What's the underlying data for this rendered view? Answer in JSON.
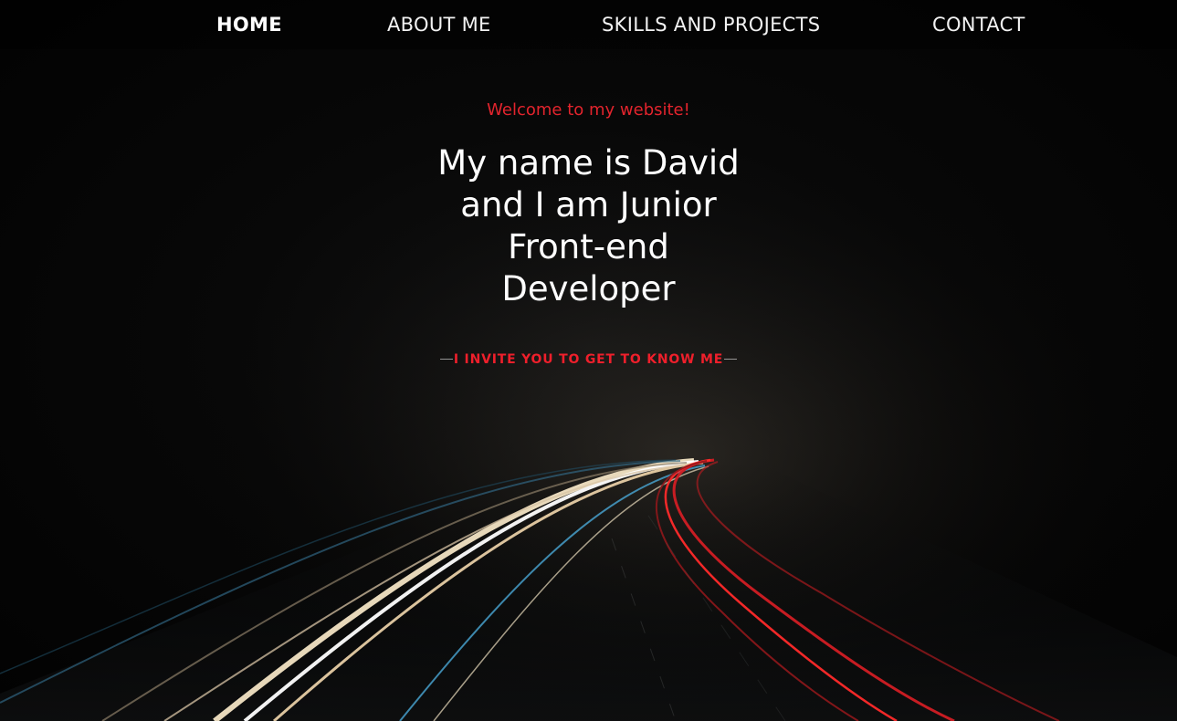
{
  "nav": {
    "home_label": "HOME",
    "about_label": "ABOUT ME",
    "skills_label": "SKILLS AND PROJECTS",
    "contact_label": "CONTACT"
  },
  "hero": {
    "welcome": "Welcome to my website!",
    "headline_lines": [
      "My name is David",
      "and I am Junior",
      "Front-end",
      "Developer"
    ],
    "cta_label": "I INVITE YOU TO GET TO KNOW ME"
  },
  "colors": {
    "accent": "#ef1f2b",
    "text": "#ffffff",
    "background": "#000000"
  }
}
